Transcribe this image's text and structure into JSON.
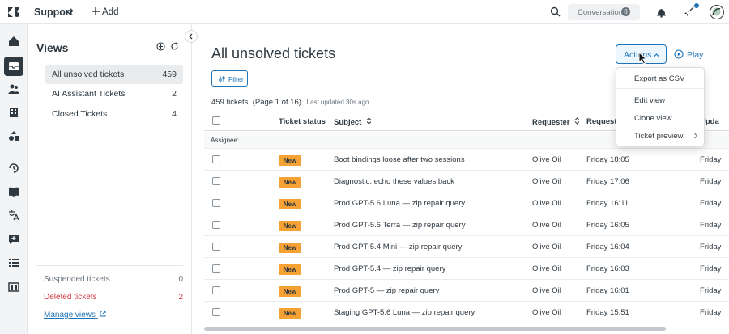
{
  "topbar": {
    "product": "Support",
    "add_label": "Add",
    "conversations_label": "Conversations",
    "conversations_count": "0"
  },
  "views": {
    "title": "Views",
    "items": [
      {
        "label": "All unsolved tickets",
        "count": "459"
      },
      {
        "label": "AI Assistant Tickets",
        "count": "2"
      },
      {
        "label": "Closed Tickets",
        "count": "4"
      }
    ],
    "suspended": {
      "label": "Suspended tickets",
      "count": "0"
    },
    "deleted": {
      "label": "Deleted tickets",
      "count": "2"
    },
    "manage_label": "Manage views"
  },
  "main": {
    "title": "All unsolved tickets",
    "actions_label": "Actions",
    "play_label": "Play",
    "filter_label": "Filter",
    "summary": "459 tickets  (Page 1 of 16)",
    "updated": "Last updated 30s ago",
    "columns": [
      "Ticket status",
      "Subject",
      "Requester",
      "Requeste",
      "Upda"
    ],
    "group_label": "Assignee:",
    "rows": [
      {
        "status": "New",
        "subject": "Boot bindings loose after two sessions",
        "requester": "Olive Oil",
        "updated": "Friday 18:05",
        "last": "Friday"
      },
      {
        "status": "New",
        "subject": "Diagnostic: echo these values back",
        "requester": "Olive Oil",
        "updated": "Friday 17:06",
        "last": "Friday"
      },
      {
        "status": "New",
        "subject": "Prod GPT-5.6 Luna — zip repair query",
        "requester": "Olive Oil",
        "updated": "Friday 16:11",
        "last": "Friday"
      },
      {
        "status": "New",
        "subject": "Prod GPT-5.6 Terra — zip repair query",
        "requester": "Olive Oil",
        "updated": "Friday 16:05",
        "last": "Friday"
      },
      {
        "status": "New",
        "subject": "Prod GPT-5.4 Mini — zip repair query",
        "requester": "Olive Oil",
        "updated": "Friday 16:04",
        "last": "Friday"
      },
      {
        "status": "New",
        "subject": "Prod GPT-5.4 — zip repair query",
        "requester": "Olive Oil",
        "updated": "Friday 16:03",
        "last": "Friday"
      },
      {
        "status": "New",
        "subject": "Prod GPT-5 — zip repair query",
        "requester": "Olive Oil",
        "updated": "Friday 16:01",
        "last": "Friday"
      },
      {
        "status": "New",
        "subject": "Staging GPT-5.6 Luna — zip repair query",
        "requester": "Olive Oil",
        "updated": "Friday 15:51",
        "last": "Friday"
      }
    ]
  },
  "dropdown": {
    "export": "Export as CSV",
    "edit": "Edit view",
    "clone": "Clone view",
    "preview": "Ticket preview"
  },
  "colors": {
    "accent": "#1f73b7",
    "badge_new": "#f5a133",
    "danger": "#cc3340",
    "dark": "#2f3941"
  }
}
